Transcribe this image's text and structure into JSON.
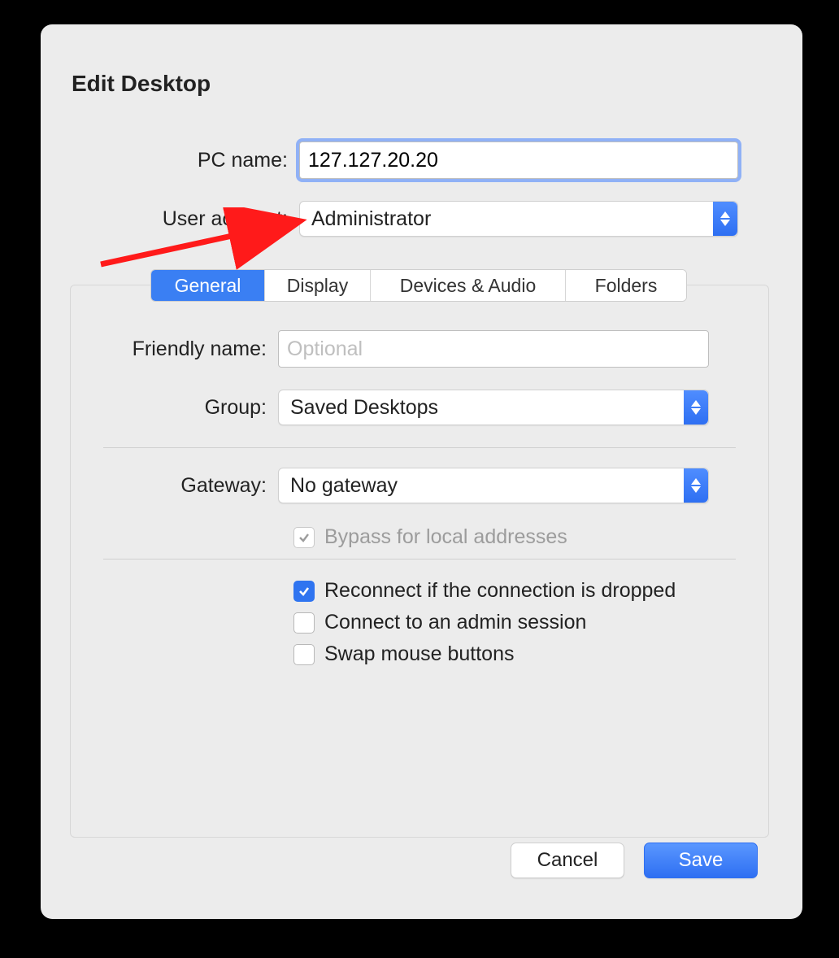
{
  "title": "Edit Desktop",
  "form": {
    "pc_name_label": "PC name:",
    "pc_name_value": "127.127.20.20",
    "user_account_label": "User account:",
    "user_account_value": "Administrator"
  },
  "tabs": {
    "general": "General",
    "display": "Display",
    "devices": "Devices & Audio",
    "folders": "Folders",
    "active": "general"
  },
  "general": {
    "friendly_name_label": "Friendly name:",
    "friendly_name_value": "",
    "friendly_name_placeholder": "Optional",
    "group_label": "Group:",
    "group_value": "Saved Desktops",
    "gateway_label": "Gateway:",
    "gateway_value": "No gateway",
    "bypass_label": "Bypass for local addresses",
    "bypass_checked": true,
    "bypass_disabled": true,
    "reconnect_label": "Reconnect if the connection is dropped",
    "reconnect_checked": true,
    "admin_label": "Connect to an admin session",
    "admin_checked": false,
    "swap_label": "Swap mouse buttons",
    "swap_checked": false
  },
  "footer": {
    "cancel": "Cancel",
    "save": "Save"
  },
  "colors": {
    "accent": "#2f74f0",
    "annotation_arrow": "#ff0000"
  }
}
